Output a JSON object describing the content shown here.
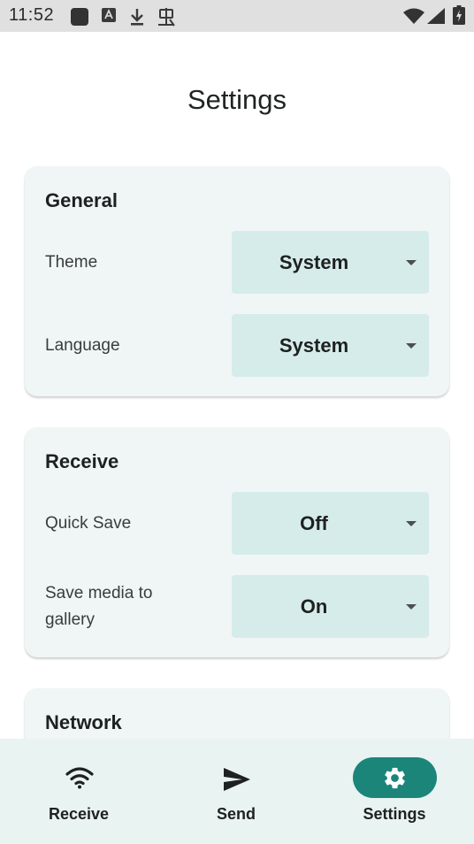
{
  "status_bar": {
    "time": "11:52"
  },
  "page": {
    "title": "Settings"
  },
  "sections": [
    {
      "title": "General",
      "settings": [
        {
          "label": "Theme",
          "value": "System"
        },
        {
          "label": "Language",
          "value": "System"
        }
      ]
    },
    {
      "title": "Receive",
      "settings": [
        {
          "label": "Quick Save",
          "value": "Off"
        },
        {
          "label": "Save media to gallery",
          "value": "On"
        }
      ]
    },
    {
      "title": "Network",
      "settings": []
    }
  ],
  "bottom_nav": {
    "items": [
      {
        "label": "Receive",
        "icon": "wifi-icon",
        "active": false
      },
      {
        "label": "Send",
        "icon": "send-icon",
        "active": false
      },
      {
        "label": "Settings",
        "icon": "gear-icon",
        "active": true
      }
    ]
  },
  "colors": {
    "card_background": "#f0f6f5",
    "dropdown_background": "#d6ecea",
    "nav_background": "#e8f3f2",
    "accent": "#1b857a"
  }
}
